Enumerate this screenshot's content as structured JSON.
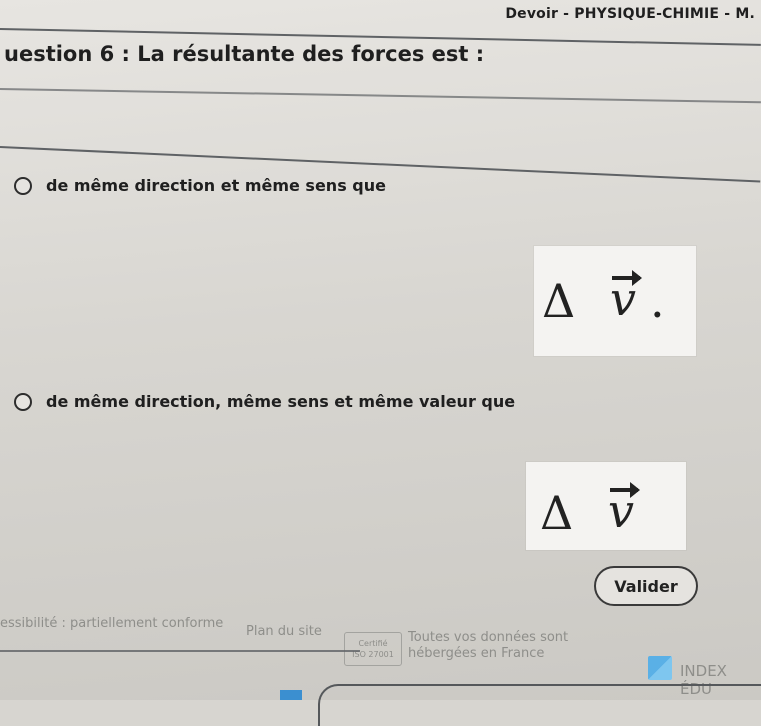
{
  "header": {
    "doc_title": "Devoir - PHYSIQUE-CHIMIE - M."
  },
  "question": {
    "label": "uestion 6 :",
    "text": "La résultante des forces est :"
  },
  "options": [
    {
      "label": "de même direction et même sens que",
      "formula_symbol": "Δ",
      "formula_vector": "v",
      "formula_suffix": "."
    },
    {
      "label": "de même direction, même sens et même valeur que",
      "formula_symbol": "Δ",
      "formula_vector": "v",
      "formula_suffix": ""
    }
  ],
  "actions": {
    "validate_label": "Valider"
  },
  "footer": {
    "accessibility": "essibilité : partiellement conforme",
    "sitemap": "Plan du site",
    "cert_line1": "Certifié",
    "cert_line2": "ISO 27001",
    "data_line1": "Toutes vos données sont",
    "data_line2": "hébergées en France",
    "brand": "INDEX ÉDU"
  }
}
